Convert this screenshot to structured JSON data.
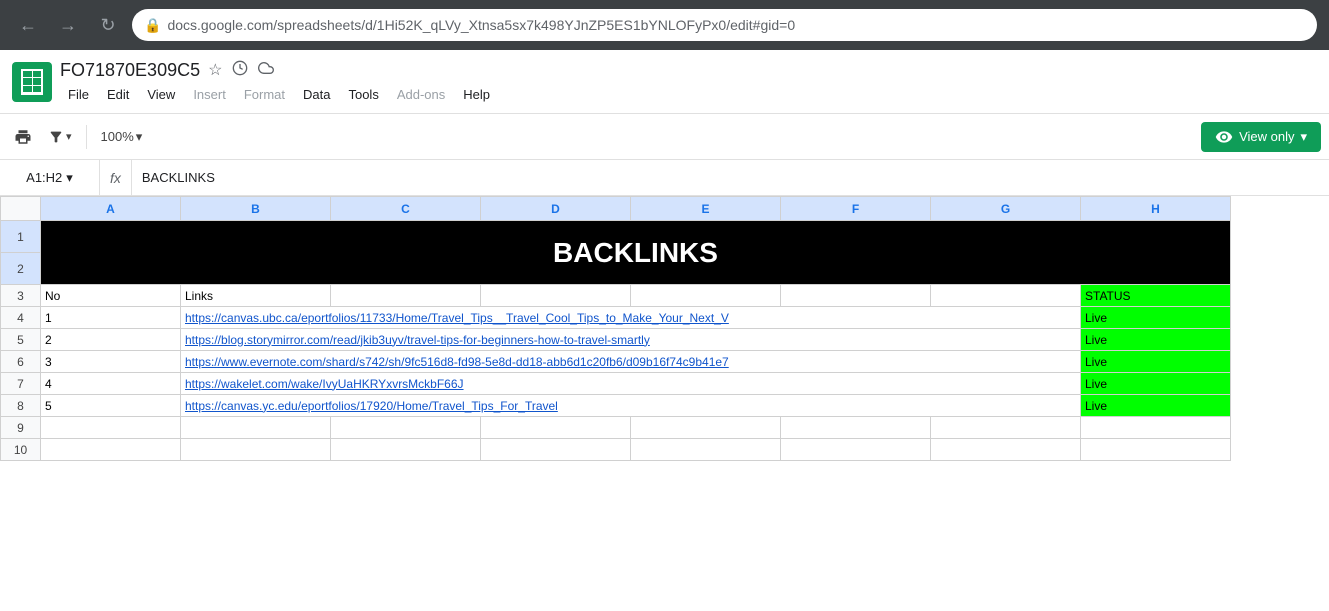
{
  "browser": {
    "url_prefix": "docs.google.com",
    "url_rest": "/spreadsheets/d/1Hi52K_qLVy_Xtnsa5sx7k498YJnZP5ES1bYNLOFyPx0/edit#gid=0"
  },
  "app": {
    "logo_letter": "≡",
    "doc_title": "FO71870E309C5",
    "star_icon": "☆",
    "camera_icon": "⊙",
    "cloud_icon": "☁"
  },
  "menu": {
    "items": [
      "File",
      "Edit",
      "View",
      "Insert",
      "Format",
      "Data",
      "Tools",
      "Add-ons",
      "Help"
    ]
  },
  "toolbar": {
    "print_icon": "🖨",
    "filter_icon": "▼",
    "zoom_level": "100%",
    "zoom_dropdown": "▾",
    "view_only_label": "View only",
    "eye_icon": "👁",
    "dropdown_arrow": "▾"
  },
  "formula_bar": {
    "cell_ref": "A1:H2",
    "dropdown_arrow": "▾",
    "fx_label": "fx",
    "formula_content": "BACKLINKS"
  },
  "columns": {
    "headers": [
      "A",
      "B",
      "C",
      "D",
      "E",
      "F",
      "G",
      "H"
    ]
  },
  "rows": {
    "headers": [
      1,
      2,
      3,
      4,
      5,
      6,
      7,
      8,
      9,
      10
    ]
  },
  "data": {
    "row3": {
      "a": "No",
      "b": "Links",
      "h": "STATUS"
    },
    "row4": {
      "a": "1",
      "b": "https://canvas.ubc.ca/eportfolios/11733/Home/Travel_Tips__Travel_Cool_Tips_to_Make_Your_Next_V",
      "h": "Live"
    },
    "row5": {
      "a": "2",
      "b": "https://blog.storymirror.com/read/jkib3uyv/travel-tips-for-beginners-how-to-travel-smartly",
      "h": "Live"
    },
    "row6": {
      "a": "3",
      "b": "https://www.evernote.com/shard/s742/sh/9fc516d8-fd98-5e8d-dd18-abb6d1c20fb6/d09b16f74c9b41e7",
      "h": "Live"
    },
    "row7": {
      "a": "4",
      "b": "https://wakelet.com/wake/IvyUaHKRYxvrsMckbF66J",
      "h": "Live"
    },
    "row8": {
      "a": "5",
      "b": "https://canvas.yc.edu/eportfolios/17920/Home/Travel_Tips_For_Travel",
      "h": "Live"
    }
  }
}
